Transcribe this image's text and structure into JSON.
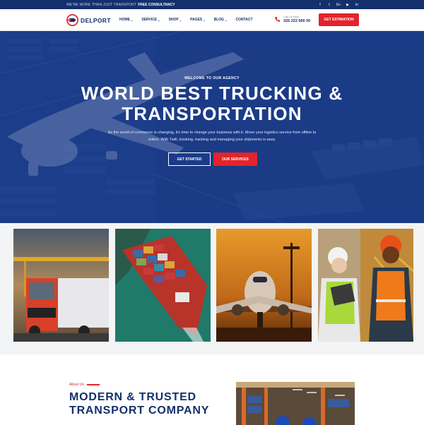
{
  "topbar": {
    "text": "WE'RE MORE THAN JUST TRANSPORT",
    "highlight": "FREE CONSULTANCY",
    "socials": [
      "facebook-icon",
      "twitter-icon",
      "google-plus-icon",
      "youtube-icon",
      "linkedin-icon"
    ]
  },
  "brand": {
    "name": "DELPORT",
    "primary": "#13306c",
    "accent": "#e3242b"
  },
  "nav": {
    "items": [
      {
        "label": "HOME",
        "has_dropdown": true
      },
      {
        "label": "SERVICE",
        "has_dropdown": true
      },
      {
        "label": "SHOP",
        "has_dropdown": true
      },
      {
        "label": "PAGES",
        "has_dropdown": true
      },
      {
        "label": "BLOG",
        "has_dropdown": true
      },
      {
        "label": "CONTACT",
        "has_dropdown": false
      }
    ],
    "phone_label": "Call Us Now",
    "phone_number": "326 222 666 00",
    "cta_label": "GET ESTIMATION"
  },
  "hero": {
    "kicker": "WELCOME TO OUR AGENCY",
    "title_line1": "WORLD BEST TRUCKING &",
    "title_line2": "TRANSPORTATION",
    "desc_line1": "As the world of commerce is changing, it's time to change your business with it. Move your logistics service from offline to",
    "desc_line2": "online. With Twill, booking, tracking and managing your shipments is easy.",
    "btn_start": "GET STARTED",
    "btn_services": "OUR SERVICES"
  },
  "gallery": {
    "tiles": [
      "truck-photo",
      "cargo-ship-photo",
      "airplane-photo",
      "workers-photo"
    ]
  },
  "about": {
    "kicker": "About Us",
    "title_line1": "MODERN & TRUSTED",
    "title_line2": "TRANSPORT COMPANY"
  }
}
